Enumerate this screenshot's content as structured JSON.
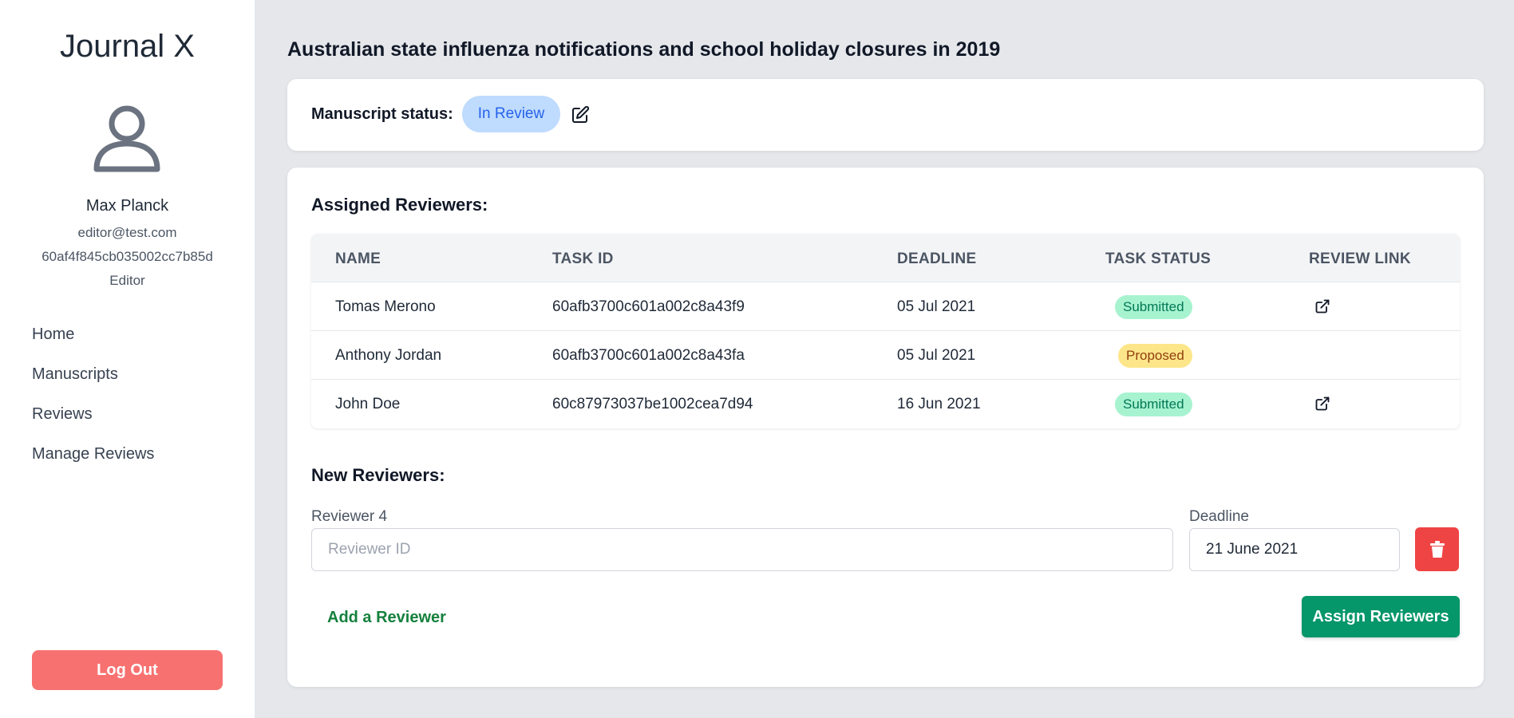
{
  "sidebar": {
    "app_title": "Journal X",
    "user": {
      "name": "Max Planck",
      "email": "editor@test.com",
      "id": "60af4f845cb035002cc7b85d",
      "role": "Editor"
    },
    "nav": [
      {
        "label": "Home"
      },
      {
        "label": "Manuscripts"
      },
      {
        "label": "Reviews"
      },
      {
        "label": "Manage Reviews"
      }
    ],
    "logout_label": "Log Out"
  },
  "main": {
    "title": "Australian state influenza notifications and school holiday closures in 2019",
    "status": {
      "label": "Manuscript status:",
      "value": "In Review"
    },
    "assigned": {
      "title": "Assigned Reviewers:",
      "headers": [
        "NAME",
        "TASK ID",
        "DEADLINE",
        "TASK STATUS",
        "REVIEW LINK"
      ],
      "rows": [
        {
          "name": "Tomas Merono",
          "task_id": "60afb3700c601a002c8a43f9",
          "deadline": "05 Jul 2021",
          "status": "Submitted",
          "has_link": true
        },
        {
          "name": "Anthony Jordan",
          "task_id": "60afb3700c601a002c8a43fa",
          "deadline": "05 Jul 2021",
          "status": "Proposed",
          "has_link": false
        },
        {
          "name": "John Doe",
          "task_id": "60c87973037be1002cea7d94",
          "deadline": "16 Jun 2021",
          "status": "Submitted",
          "has_link": true
        }
      ]
    },
    "new_reviewers": {
      "title": "New Reviewers:",
      "reviewer_label": "Reviewer 4",
      "reviewer_placeholder": "Reviewer ID",
      "reviewer_value": "",
      "deadline_label": "Deadline",
      "deadline_value": "21 June 2021",
      "add_label": "Add a Reviewer",
      "assign_label": "Assign Reviewers"
    }
  },
  "colors": {
    "accent_green": "#059669",
    "danger_red": "#ef4444",
    "logout_red": "#f87171",
    "status_blue": "#bfdbfe"
  }
}
